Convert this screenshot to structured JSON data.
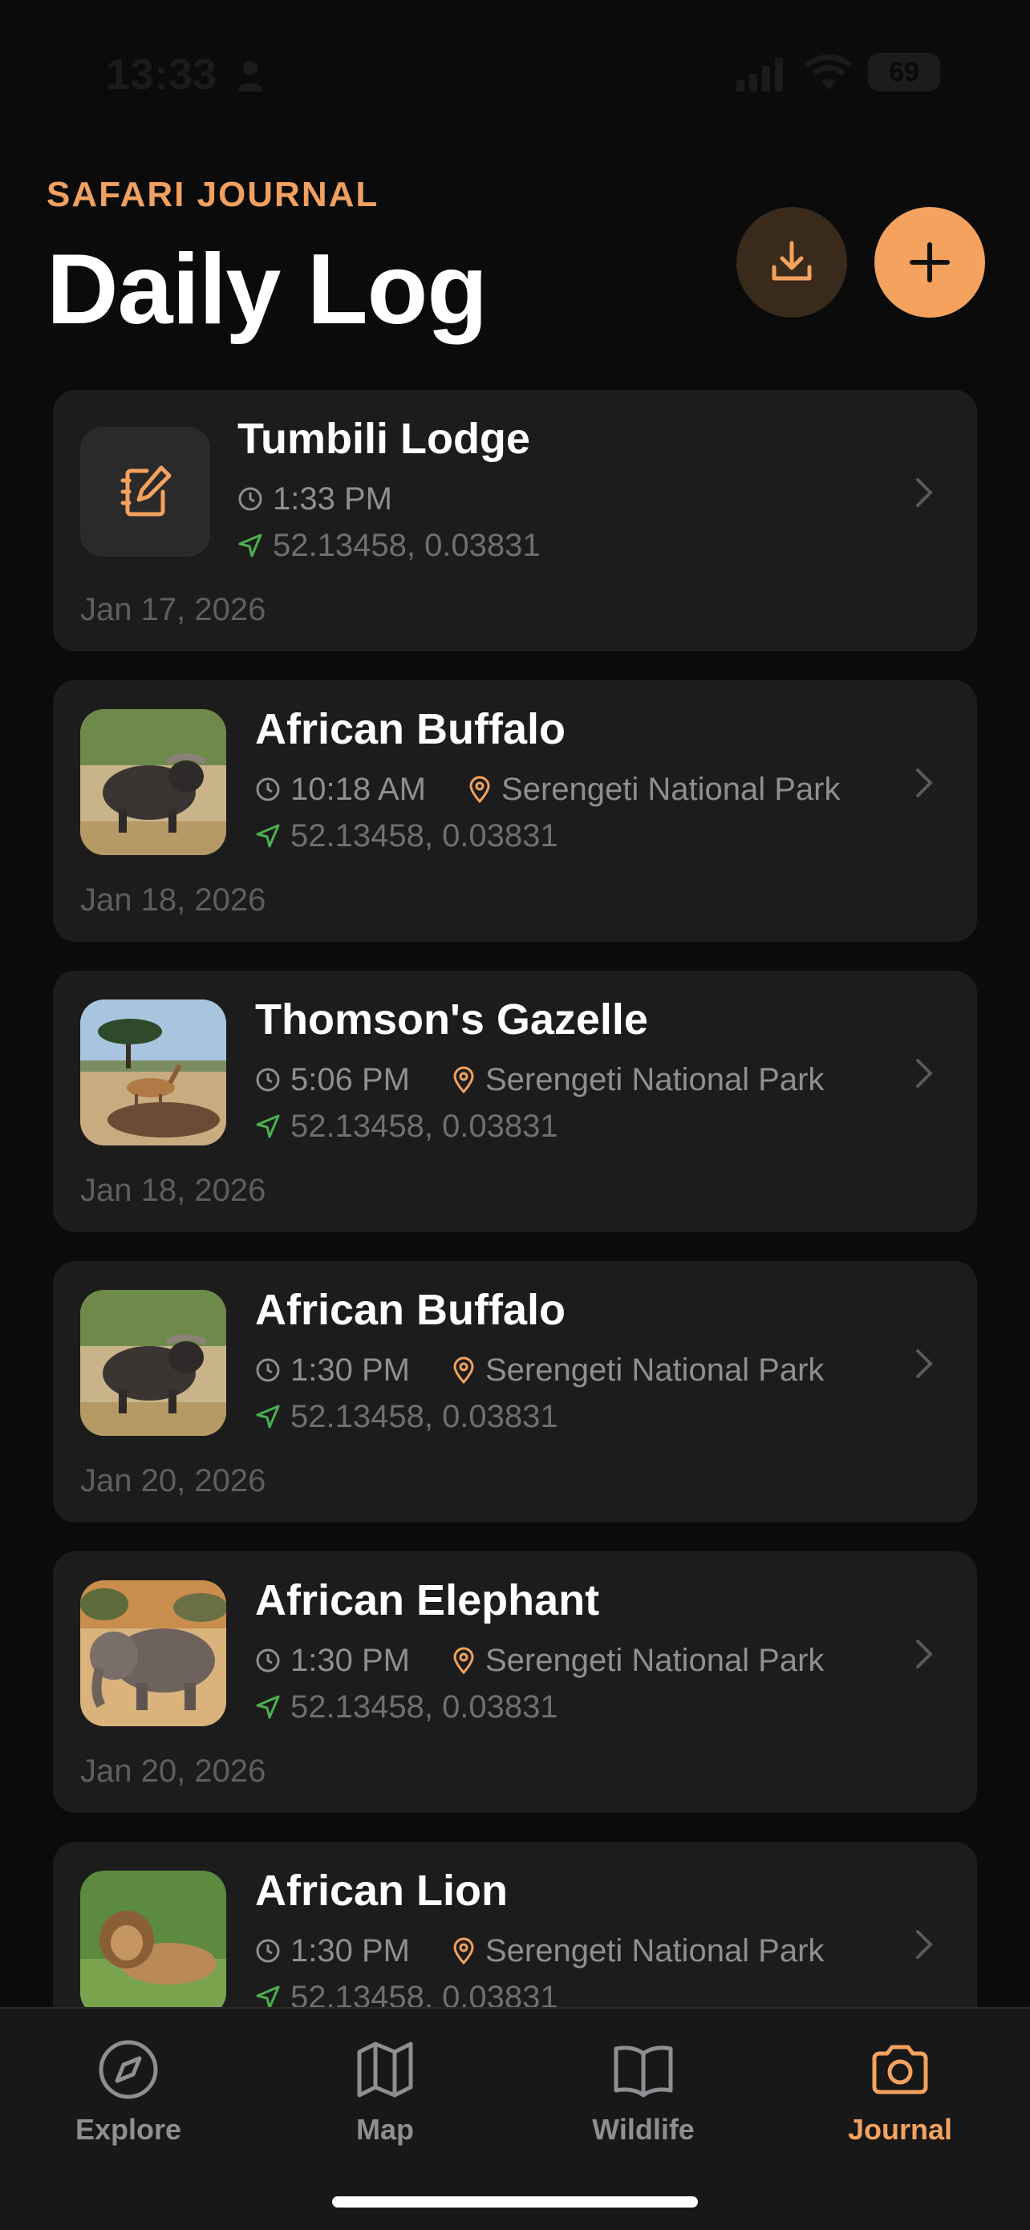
{
  "status": {
    "time": "13:33",
    "battery": "69"
  },
  "header": {
    "eyebrow": "SAFARI JOURNAL",
    "title": "Daily Log"
  },
  "colors": {
    "accent": "#f4a25e",
    "card": "#1c1c1c",
    "background": "#0b0b0b",
    "coords_icon": "#4caf50"
  },
  "entries": [
    {
      "title": "Tumbili Lodge",
      "time": "1:33 PM",
      "location": "",
      "coords": "52.13458, 0.03831",
      "date": "Jan 17, 2026",
      "thumb": "notebook-pen-icon"
    },
    {
      "title": "African Buffalo",
      "time": "10:18 AM",
      "location": "Serengeti National Park",
      "coords": "52.13458, 0.03831",
      "date": "Jan 18, 2026",
      "thumb": "buffalo-photo"
    },
    {
      "title": "Thomson's Gazelle",
      "time": "5:06 PM",
      "location": "Serengeti National Park",
      "coords": "52.13458, 0.03831",
      "date": "Jan 18, 2026",
      "thumb": "gazelle-photo"
    },
    {
      "title": "African Buffalo",
      "time": "1:30 PM",
      "location": "Serengeti National Park",
      "coords": "52.13458, 0.03831",
      "date": "Jan 20, 2026",
      "thumb": "buffalo-photo"
    },
    {
      "title": "African Elephant",
      "time": "1:30 PM",
      "location": "Serengeti National Park",
      "coords": "52.13458, 0.03831",
      "date": "Jan 20, 2026",
      "thumb": "elephant-photo"
    },
    {
      "title": "African Lion",
      "time": "1:30 PM",
      "location": "Serengeti National Park",
      "coords": "52.13458, 0.03831",
      "date": "",
      "thumb": "lion-photo"
    }
  ],
  "tabs": [
    {
      "label": "Explore",
      "icon": "compass-icon",
      "active": false
    },
    {
      "label": "Map",
      "icon": "map-icon",
      "active": false
    },
    {
      "label": "Wildlife",
      "icon": "book-icon",
      "active": false
    },
    {
      "label": "Journal",
      "icon": "camera-icon",
      "active": true
    }
  ]
}
